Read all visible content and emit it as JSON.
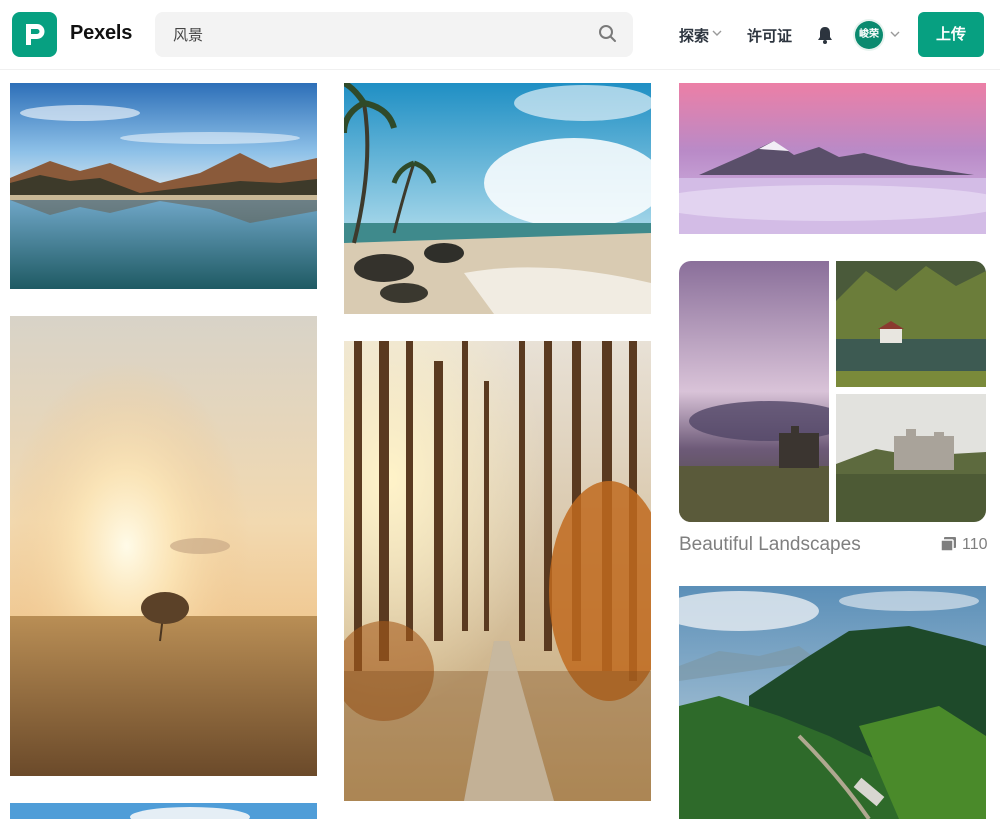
{
  "header": {
    "logo_text": "Pexels",
    "search_value": "风景",
    "nav": {
      "explore_label": "探索",
      "license_label": "许可证"
    },
    "avatar_text": "峻荣",
    "upload_label": "上传"
  },
  "collection": {
    "title": "Beautiful Landscapes",
    "count": "110"
  },
  "colors": {
    "brand": "#07a081"
  }
}
